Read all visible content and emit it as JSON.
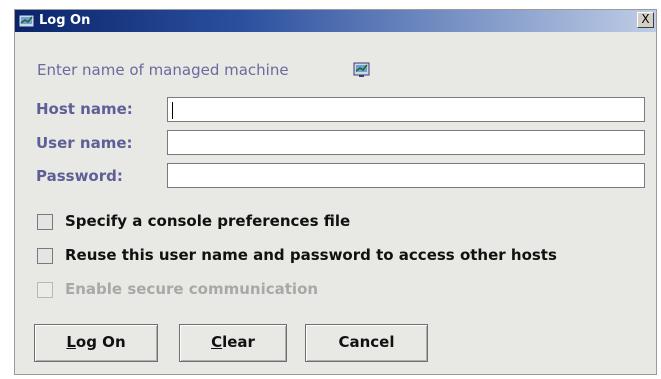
{
  "window": {
    "title": "Log On",
    "close_glyph": "X"
  },
  "subtitle": "Enter name of managed machine",
  "fields": [
    {
      "label": "Host name:",
      "value": ""
    },
    {
      "label": "User name:",
      "value": ""
    },
    {
      "label": "Password:",
      "value": ""
    }
  ],
  "checkboxes": [
    {
      "label": "Specify a console preferences file",
      "checked": false,
      "enabled": true
    },
    {
      "label": "Reuse this user name and password to access other hosts",
      "checked": false,
      "enabled": true
    },
    {
      "label": "Enable secure communication",
      "checked": false,
      "enabled": false
    }
  ],
  "buttons": {
    "logon": {
      "mnemonic": "L",
      "rest": "og On"
    },
    "clear": {
      "mnemonic": "C",
      "rest": "lear"
    },
    "cancel": {
      "label": "Cancel"
    }
  },
  "icons": {
    "title": "managed-machine-icon",
    "subtitle": "managed-machine-icon",
    "close": "close-icon"
  },
  "colors": {
    "title_bar_start": "#0a246a",
    "title_bar_end": "#bfcde6",
    "label_text": "#5f5f98",
    "dialog_background": "#e8e8e4"
  }
}
